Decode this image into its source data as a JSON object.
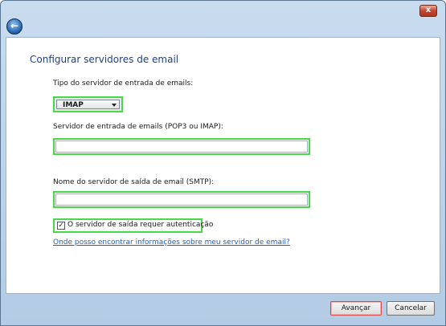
{
  "window": {
    "close_glyph": "x",
    "back_glyph": "←"
  },
  "page": {
    "title": "Configurar servidores de email",
    "incoming_type_label": "Tipo do servidor de entrada de emails:",
    "incoming_type_value": "IMAP",
    "incoming_server_label": "Servidor de entrada de emails (POP3 ou IMAP):",
    "incoming_server_value": "",
    "outgoing_server_label": "Nome do servidor de saída de email (SMTP):",
    "outgoing_server_value": "",
    "auth_checkbox_label": "O servidor de saída requer autenticação",
    "auth_checked": true,
    "check_glyph": "✓",
    "help_link": "Onde posso encontrar informações sobre meu servidor de email?"
  },
  "footer": {
    "next_label": "Avançar",
    "cancel_label": "Cancelar"
  },
  "colors": {
    "highlight": "#47d947",
    "title": "#1e3f8a",
    "link": "#1c5fbf"
  }
}
